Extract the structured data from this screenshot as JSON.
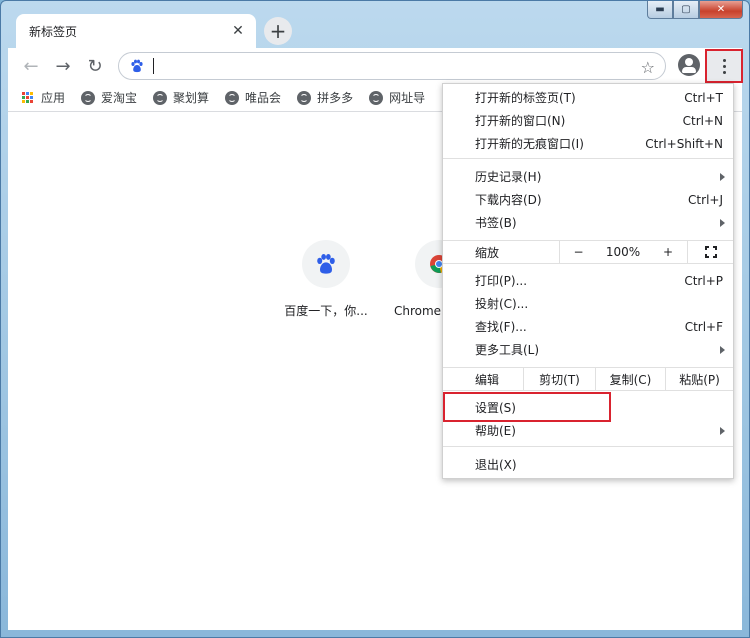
{
  "window": {
    "caption": {
      "minimize": "▬",
      "maximize": "▢",
      "close": "✕"
    }
  },
  "tabs": [
    {
      "title": "新标签页",
      "close_glyph": "✕"
    }
  ],
  "new_tab_glyph": "+",
  "toolbar": {
    "back_glyph": "←",
    "forward_glyph": "→",
    "reload_glyph": "↻",
    "omnibox_value": "",
    "star_glyph": "☆"
  },
  "bookmarks": [
    {
      "label": "应用",
      "icon": "apps-icon"
    },
    {
      "label": "爱淘宝",
      "icon": "globe-icon"
    },
    {
      "label": "聚划算",
      "icon": "globe-icon"
    },
    {
      "label": "唯品会",
      "icon": "globe-icon"
    },
    {
      "label": "拼多多",
      "icon": "globe-icon"
    },
    {
      "label": "网址导",
      "icon": "globe-icon"
    }
  ],
  "shortcuts": [
    {
      "label": "百度一下，你...",
      "icon": "baidu-icon"
    },
    {
      "label": "Chrome 网上应用店",
      "icon": "chrome-icon"
    }
  ],
  "menu": {
    "new_tab": {
      "label": "打开新的标签页(T)",
      "shortcut": "Ctrl+T"
    },
    "new_window": {
      "label": "打开新的窗口(N)",
      "shortcut": "Ctrl+N"
    },
    "incognito": {
      "label": "打开新的无痕窗口(I)",
      "shortcut": "Ctrl+Shift+N"
    },
    "history": {
      "label": "历史记录(H)"
    },
    "downloads": {
      "label": "下载内容(D)",
      "shortcut": "Ctrl+J"
    },
    "bookmarks": {
      "label": "书签(B)"
    },
    "zoom": {
      "label": "缩放",
      "minus": "−",
      "value": "100%",
      "plus": "+"
    },
    "print": {
      "label": "打印(P)...",
      "shortcut": "Ctrl+P"
    },
    "cast": {
      "label": "投射(C)..."
    },
    "find": {
      "label": "查找(F)...",
      "shortcut": "Ctrl+F"
    },
    "more_tools": {
      "label": "更多工具(L)"
    },
    "edit": {
      "label": "编辑",
      "cut": "剪切(T)",
      "copy": "复制(C)",
      "paste": "粘贴(P)"
    },
    "settings": {
      "label": "设置(S)"
    },
    "help": {
      "label": "帮助(E)"
    },
    "exit": {
      "label": "退出(X)"
    }
  },
  "colors": {
    "highlight": "#d9232f",
    "baidu_blue": "#2e5ee8"
  }
}
